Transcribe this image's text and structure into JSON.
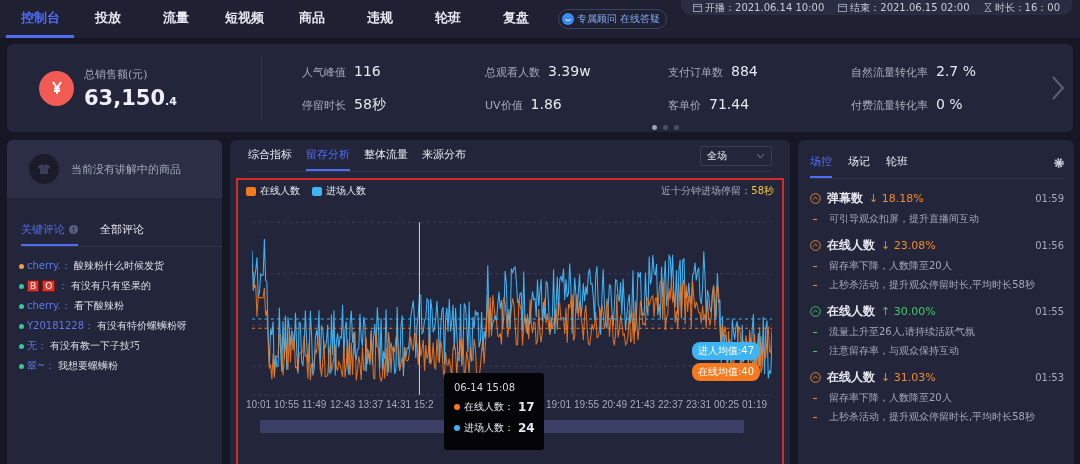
{
  "nav": {
    "tabs": [
      {
        "label": "控制台",
        "selected": true
      },
      {
        "label": "投放",
        "selected": false
      },
      {
        "label": "流量",
        "selected": false
      },
      {
        "label": "短视频",
        "selected": false
      },
      {
        "label": "商品",
        "selected": false
      },
      {
        "label": "违规",
        "selected": false
      },
      {
        "label": "轮班",
        "selected": false
      },
      {
        "label": "复盘",
        "selected": false
      }
    ],
    "advisor": "专属顾问 在线答疑",
    "session": [
      {
        "kind": "start",
        "text": "开播：2021.06.14 10:00"
      },
      {
        "kind": "end",
        "text": "结束：2021.06.15 02:00"
      },
      {
        "kind": "duration",
        "text": "时长：16：00"
      }
    ]
  },
  "summary": {
    "label": "总销售额(元)",
    "integer": "63,150",
    "decimal": ".4",
    "metrics": [
      {
        "label": "人气峰值",
        "value": "116"
      },
      {
        "label": "总观看人数",
        "value": "3.39w"
      },
      {
        "label": "支付订单数",
        "value": "884"
      },
      {
        "label": "自然流量转化率",
        "value": "2.7 %"
      },
      {
        "label": "停留时长",
        "value": "58秒"
      },
      {
        "label": "UV价值",
        "value": "1.86"
      },
      {
        "label": "客单价",
        "value": "71.44"
      },
      {
        "label": "付费流量转化率",
        "value": "0 %"
      }
    ],
    "pages": [
      {
        "selected": true
      },
      {
        "selected": false
      },
      {
        "selected": false
      }
    ]
  },
  "product": {
    "text": "当前没有讲解中的商品"
  },
  "comments": {
    "tabs": [
      {
        "label": "关键评论",
        "selected": true
      },
      {
        "label": "全部评论",
        "selected": false
      }
    ],
    "items": [
      {
        "color": "#f0a040",
        "user": "cherry.：",
        "text": "酸辣粉什么时候发货"
      },
      {
        "color": "#3cc49a",
        "badges": [
          "B",
          "O"
        ],
        "sep": "：",
        "text": "有没有只有坚果的"
      },
      {
        "color": "#3cc49a",
        "user": "cherry.：",
        "text": "看下酸辣粉"
      },
      {
        "color": "#3cc49a",
        "user": "Y20181228：",
        "text": "有没有特价螺蛳粉呀"
      },
      {
        "color": "#3cc49a",
        "user": "无：",
        "text": "有没有教一下子技巧"
      },
      {
        "color": "#3cc49a",
        "user": "翠~：",
        "text": "我想要螺蛳粉"
      }
    ]
  },
  "analysis": {
    "tabs": [
      {
        "label": "综合指标",
        "selected": false
      },
      {
        "label": "留存分析",
        "selected": true
      },
      {
        "label": "整体流量",
        "selected": false
      },
      {
        "label": "来源分布",
        "selected": false
      }
    ],
    "scope": "全场",
    "legend": [
      {
        "label": "在线人数",
        "color": "#f57a1f"
      },
      {
        "label": "进场人数",
        "color": "#3fb4f5"
      }
    ],
    "stay_note": "近十分钟进场停留：",
    "stay_value": "58秒",
    "x_labels": [
      "10:01",
      "10:55",
      "11:49",
      "12:43",
      "13:37",
      "14:31",
      "15:2",
      "19:01",
      "19:55",
      "20:49",
      "21:43",
      "22:37",
      "23:31",
      "00:25",
      "01:19"
    ],
    "averages": [
      {
        "label": "进人均值:47",
        "color": "#3fb4f5"
      },
      {
        "label": "在线均值:40",
        "color": "#f57a1f"
      }
    ],
    "tooltip": {
      "time": "06-14 15:08",
      "rows": [
        {
          "label": "在线人数：",
          "value": "17",
          "color": "#f57a1f"
        },
        {
          "label": "进场人数：",
          "value": "24",
          "color": "#3fb4f5"
        }
      ]
    }
  },
  "control": {
    "tabs": [
      {
        "label": "场控",
        "selected": true
      },
      {
        "label": "场记",
        "selected": false
      },
      {
        "label": "轮班",
        "selected": false
      }
    ],
    "events": [
      {
        "title": "弹幕数",
        "color": "#f08a2a",
        "change": "↓ 18.18%",
        "time": "01:59",
        "notes": [
          "可引导观众扣屏，提升直播间互动"
        ]
      },
      {
        "title": "在线人数",
        "color": "#f08a2a",
        "change": "↓ 23.08%",
        "time": "01:56",
        "notes": [
          "留存率下降，人数降至20人",
          "上秒杀活动，提升观众停留时长,平均时长58秒"
        ]
      },
      {
        "title": "在线人数",
        "color": "#44c767",
        "change": "↑ 30.00%",
        "time": "01:55",
        "notes": [
          "流量上升至26人,请持续活跃气氛",
          "注意留存率，与观众保持互动"
        ]
      },
      {
        "title": "在线人数",
        "color": "#f08a2a",
        "change": "↓ 31.03%",
        "time": "01:53",
        "notes": [
          "留存率下降，人数降至20人",
          "上秒杀活动，提升观众停留时长,平均时长58秒"
        ]
      }
    ]
  }
}
